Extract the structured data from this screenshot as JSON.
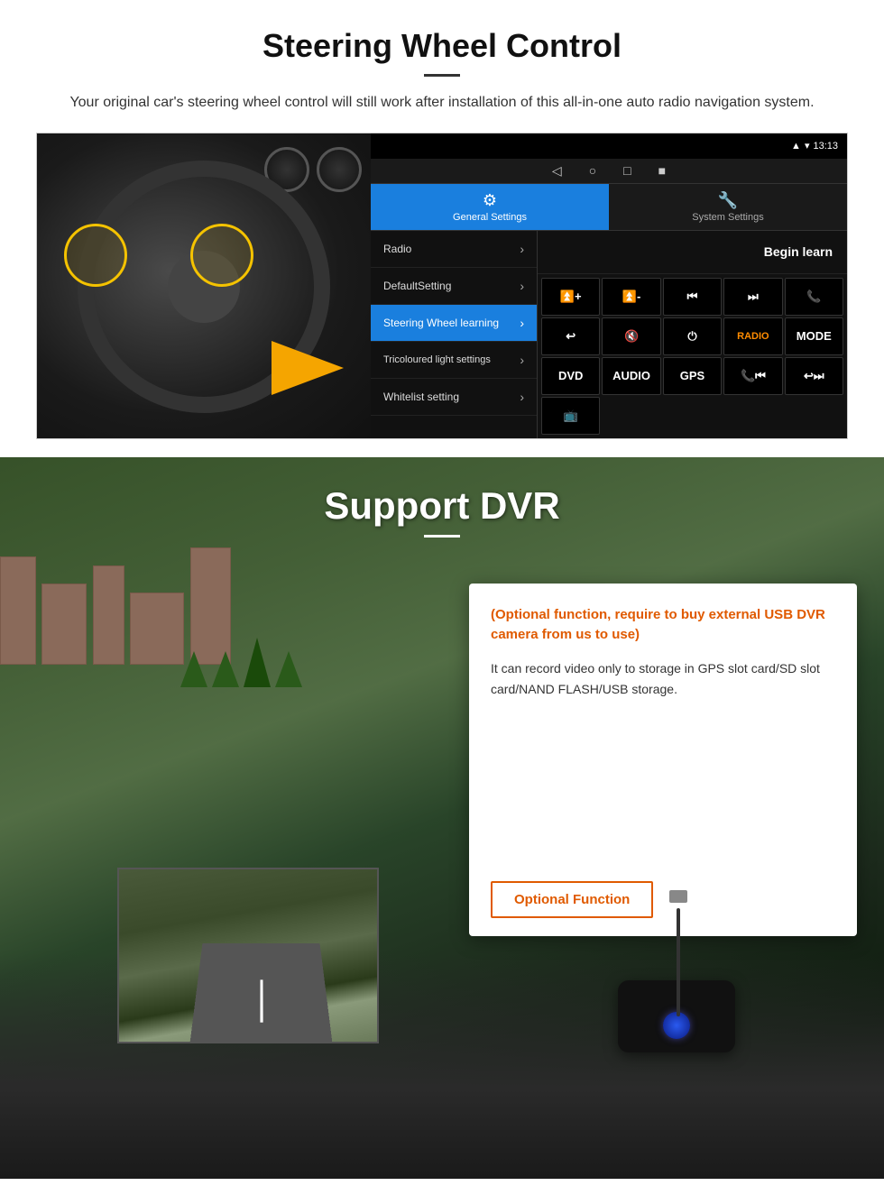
{
  "steering_section": {
    "title": "Steering Wheel Control",
    "subtitle": "Your original car's steering wheel control will still work after installation of this all-in-one auto radio navigation system.",
    "status_bar": {
      "signal": "▼",
      "wifi": "▾",
      "time": "13:13"
    },
    "nav_buttons": [
      "◁",
      "○",
      "□",
      "■"
    ],
    "tabs": [
      {
        "icon": "⚙",
        "label": "General Settings",
        "active": true
      },
      {
        "icon": "🔧",
        "label": "System Settings",
        "active": false
      }
    ],
    "menu_items": [
      {
        "label": "Radio",
        "active": false
      },
      {
        "label": "DefaultSetting",
        "active": false
      },
      {
        "label": "Steering Wheel learning",
        "active": true
      },
      {
        "label": "Tricoloured light settings",
        "active": false
      },
      {
        "label": "Whitelist setting",
        "active": false
      }
    ],
    "begin_learn_label": "Begin learn",
    "control_buttons": [
      "🔊+",
      "🔊-",
      "⏮",
      "⏭",
      "📞",
      "↩",
      "🔇",
      "⏻",
      "RADIO",
      "MODE",
      "DVD",
      "AUDIO",
      "GPS",
      "📞⏮",
      "↩⏭",
      "📺"
    ]
  },
  "dvr_section": {
    "title": "Support DVR",
    "optional_text": "(Optional function, require to buy external USB DVR camera from us to use)",
    "description": "It can record video only to storage in GPS slot card/SD slot card/NAND FLASH/USB storage.",
    "optional_button_label": "Optional Function"
  }
}
